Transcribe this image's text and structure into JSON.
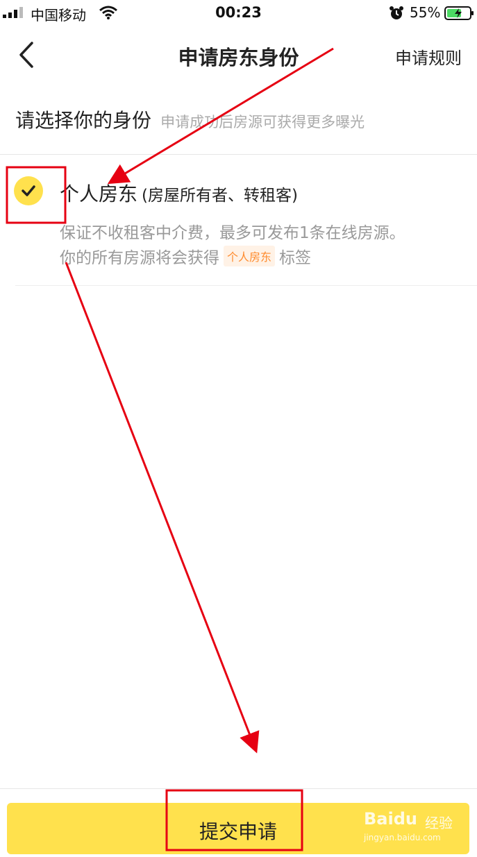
{
  "status_bar": {
    "carrier": "中国移动",
    "time": "00:23",
    "battery": "55%"
  },
  "nav": {
    "title": "申请房东身份",
    "rules": "申请规则"
  },
  "section": {
    "title": "请选择你的身份",
    "subtitle": "申请成功后房源可获得更多曝光"
  },
  "option": {
    "title": "个人房东",
    "title_paren": "(房屋所有者、转租客)",
    "desc_line1": "保证不收租客中介费，最多可发布1条在线房源。",
    "desc_line2_prefix": "你的所有房源将会获得",
    "tag": "个人房东",
    "desc_line2_suffix": "标签",
    "selected": true
  },
  "submit": {
    "label": "提交申请"
  },
  "watermark": {
    "logo": "Baidu",
    "text": "经验",
    "url": "jingyan.baidu.com"
  },
  "colors": {
    "accent": "#ffe14d",
    "tag_text": "#ff8c2f",
    "tag_bg": "#fff2e6",
    "annotation": "#e60012"
  }
}
